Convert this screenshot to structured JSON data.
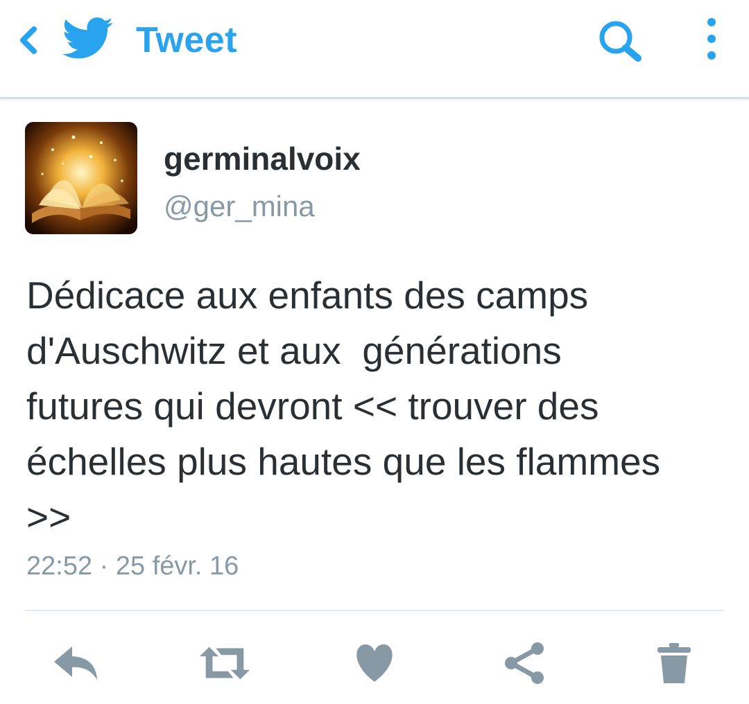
{
  "header": {
    "title": "Tweet",
    "back_icon": "chevron-left-icon",
    "logo_icon": "twitter-bird-icon",
    "search_icon": "search-icon",
    "more_icon": "more-vertical-icon",
    "accent_color": "#2aa3ef"
  },
  "tweet": {
    "display_name": "germinalvoix",
    "handle": "@ger_mina",
    "avatar_icon": "open-book-sparkle-avatar",
    "text": "Dédicace aux enfants des camps\nd'Auschwitz et aux  générations\nfutures qui devront << trouver des\néchelles plus hautes que les flammes\n>>",
    "timestamp": "22:52 · 25 févr. 16"
  },
  "actions": {
    "reply_icon": "reply-icon",
    "retweet_icon": "retweet-icon",
    "like_icon": "heart-icon",
    "share_icon": "share-icon",
    "delete_icon": "trash-icon",
    "icon_color": "#8899a6"
  }
}
